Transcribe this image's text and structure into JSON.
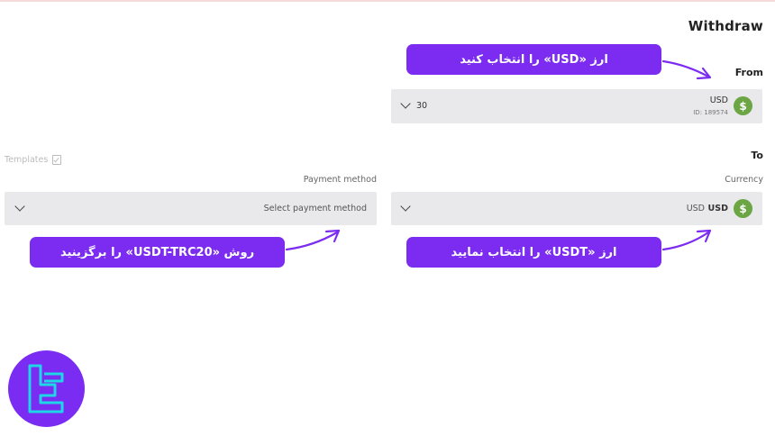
{
  "header": {
    "title": "Withdraw"
  },
  "from": {
    "label": "From",
    "account_currency": "USD",
    "account_id": "ID: 189574",
    "amount": "30",
    "coin_icon": "dollar-coin-icon"
  },
  "to": {
    "label": "To",
    "currency_label": "Currency",
    "currency_value": "USD",
    "currency_code": "USD",
    "coin_icon": "dollar-coin-icon"
  },
  "payment": {
    "label": "Payment method",
    "placeholder": "Select payment method"
  },
  "templates": {
    "label": "Templates"
  },
  "callouts": {
    "select_usd": "ارز «USD» را انتخاب کنید",
    "select_usdt": "ارز «USDT» را انتخاب نمایید",
    "select_method": "روش «USDT-TRC20» را برگزینید"
  },
  "colors": {
    "callout": "#7b2cf0",
    "coin": "#6ba544",
    "field_bg": "#e9e8ea"
  }
}
